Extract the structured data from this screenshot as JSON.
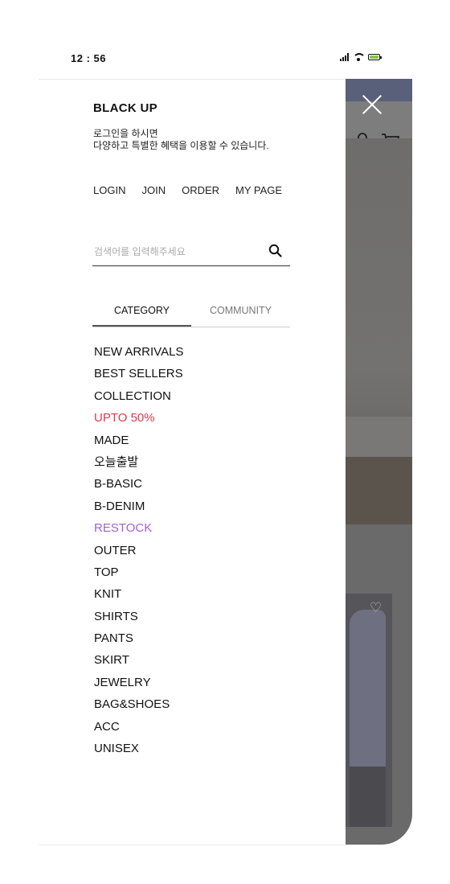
{
  "status_bar": {
    "time": "12 : 56",
    "battery_color": "#8bc34a"
  },
  "drawer": {
    "brand": "BLACK UP",
    "intro_line1": "로그인을 하시면",
    "intro_line2": "다양하고 특별한 혜택을 이용할 수 있습니다.",
    "quick_links": [
      "LOGIN",
      "JOIN",
      "ORDER",
      "MY PAGE"
    ],
    "search": {
      "placeholder": "검색어를 입력해주세요"
    },
    "tabs": [
      {
        "label": "CATEGORY"
      },
      {
        "label": "COMMUNITY"
      }
    ],
    "menu": [
      "NEW ARRIVALS",
      "BEST SELLERS",
      "COLLECTION",
      "UPTO 50%",
      "MADE",
      "오늘출발",
      "B-BASIC",
      "B-DENIM",
      "RESTOCK",
      "OUTER",
      "TOP",
      "KNIT",
      "SHIRTS",
      "PANTS",
      "SKIRT",
      "JEWELRY",
      "BAG&SHOES",
      "ACC",
      "UNISEX"
    ],
    "colors": {
      "sale": "#e0394a",
      "restock": "#a55fd8"
    }
  }
}
